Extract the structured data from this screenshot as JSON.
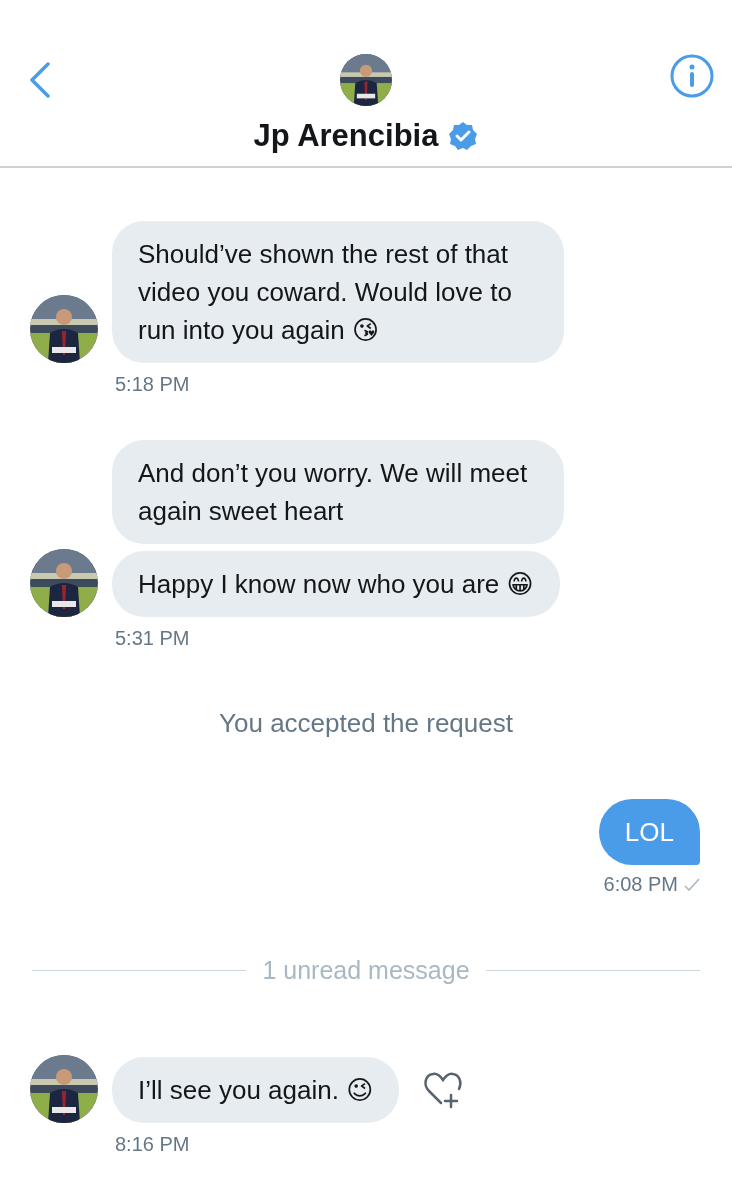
{
  "header": {
    "name": "Jp Arencibia",
    "verified": true
  },
  "items": [
    {
      "kind": "received",
      "bubbles": [
        "Should’ve shown the rest of that video you coward. Would love to run into you again 😘"
      ],
      "time": "5:18 PM"
    },
    {
      "kind": "received",
      "bubbles": [
        "And don’t you worry. We will meet again sweet heart",
        "Happy I know now who you are 😁"
      ],
      "time": "5:31 PM"
    },
    {
      "kind": "notice",
      "text": "You accepted the request"
    },
    {
      "kind": "sent",
      "bubbles": [
        "LOL"
      ],
      "time": "6:08 PM",
      "delivered": true
    },
    {
      "kind": "divider",
      "text": "1 unread message"
    },
    {
      "kind": "received",
      "bubbles": [
        "I’ll see you again. 😉"
      ],
      "time": "8:16 PM",
      "like_button": true
    }
  ]
}
